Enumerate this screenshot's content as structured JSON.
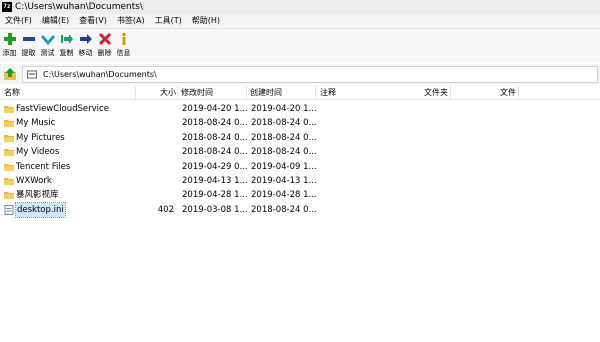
{
  "window": {
    "title": "C:\\Users\\wuhan\\Documents\\",
    "app_icon": "7z"
  },
  "menu": [
    "文件(F)",
    "编辑(E)",
    "查看(V)",
    "书签(A)",
    "工具(T)",
    "帮助(H)"
  ],
  "toolbar": [
    {
      "label": "添加",
      "icon": "add-icon"
    },
    {
      "label": "提取",
      "icon": "extract-icon"
    },
    {
      "label": "测试",
      "icon": "test-icon"
    },
    {
      "label": "复制",
      "icon": "copy-icon"
    },
    {
      "label": "移动",
      "icon": "move-icon"
    },
    {
      "label": "删除",
      "icon": "delete-icon"
    },
    {
      "label": "信息",
      "icon": "info-icon"
    }
  ],
  "address": {
    "path": "C:\\Users\\wuhan\\Documents\\"
  },
  "columns": [
    "名称",
    "大小",
    "修改时间",
    "创建时间",
    "注释",
    "文件夹",
    "文件"
  ],
  "rows": [
    {
      "name": "FastViewCloudService",
      "size": "",
      "modified": "2019-04-20 1...",
      "created": "2019-04-20 1...",
      "type": "folder"
    },
    {
      "name": "My Music",
      "size": "",
      "modified": "2018-08-24 0...",
      "created": "2018-08-24 0...",
      "type": "folder"
    },
    {
      "name": "My Pictures",
      "size": "",
      "modified": "2018-08-24 0...",
      "created": "2018-08-24 0...",
      "type": "folder"
    },
    {
      "name": "My Videos",
      "size": "",
      "modified": "2018-08-24 0...",
      "created": "2018-08-24 0...",
      "type": "folder"
    },
    {
      "name": "Tencent Files",
      "size": "",
      "modified": "2019-04-29 0...",
      "created": "2019-04-09 1...",
      "type": "folder"
    },
    {
      "name": "WXWork",
      "size": "",
      "modified": "2019-04-13 1...",
      "created": "2019-04-13 1...",
      "type": "folder"
    },
    {
      "name": "暴风影视库",
      "size": "",
      "modified": "2019-04-28 1...",
      "created": "2019-04-28 1...",
      "type": "folder"
    },
    {
      "name": "desktop.ini",
      "size": "402",
      "modified": "2019-03-08 1...",
      "created": "2018-08-24 0...",
      "type": "file",
      "selected": true
    }
  ],
  "colors": {
    "selection": "#cce8ff",
    "folder": "#e8b840",
    "add": "#1aa01a",
    "delete": "#d42020"
  }
}
